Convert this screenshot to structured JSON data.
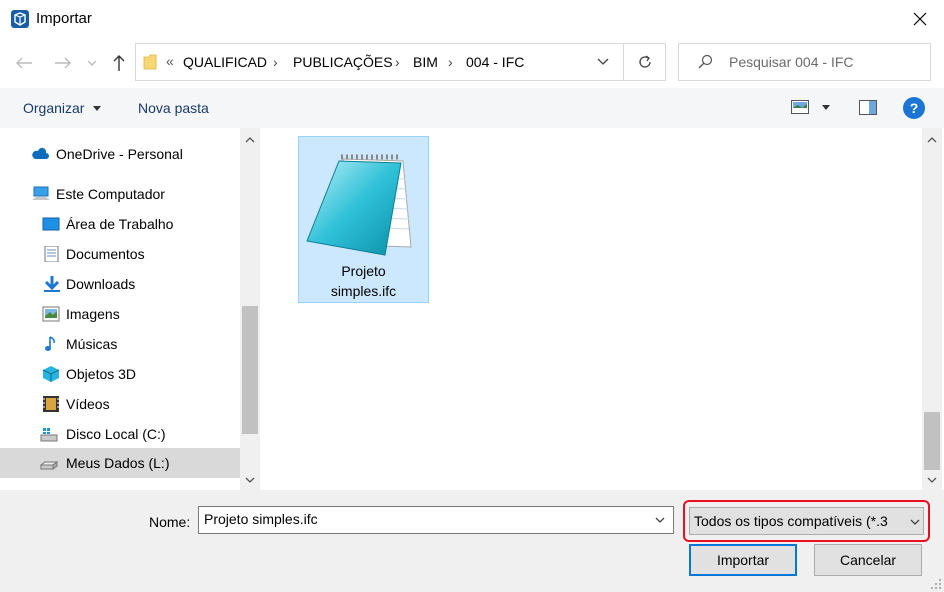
{
  "window": {
    "title": "Importar"
  },
  "nav": {
    "breadcrumb_overflow": "«",
    "breadcrumbs": [
      "QUALIFICAD",
      "PUBLICAÇÕES",
      "BIM",
      "004 - IFC"
    ],
    "search_placeholder": "Pesquisar 004 - IFC"
  },
  "toolbar": {
    "organize_label": "Organizar",
    "new_folder_label": "Nova pasta",
    "help_label": "?"
  },
  "sidebar": {
    "items": [
      {
        "label": "OneDrive - Personal",
        "icon": "onedrive-icon"
      },
      {
        "label": "Este Computador",
        "icon": "computer-icon"
      },
      {
        "label": "Área de Trabalho",
        "icon": "desktop-icon"
      },
      {
        "label": "Documentos",
        "icon": "documents-icon"
      },
      {
        "label": "Downloads",
        "icon": "downloads-icon"
      },
      {
        "label": "Imagens",
        "icon": "pictures-icon"
      },
      {
        "label": "Músicas",
        "icon": "music-icon"
      },
      {
        "label": "Objetos 3D",
        "icon": "objects-3d-icon"
      },
      {
        "label": "Vídeos",
        "icon": "videos-icon"
      },
      {
        "label": "Disco Local (C:)",
        "icon": "drive-c-icon"
      },
      {
        "label": "Meus Dados (L:)",
        "icon": "drive-l-icon",
        "selected": true
      }
    ]
  },
  "files": [
    {
      "name_line1": "Projeto",
      "name_line2": "simples.ifc",
      "icon": "notepad-file-icon"
    }
  ],
  "footer": {
    "name_label": "Nome:",
    "name_value": "Projeto simples.ifc",
    "file_type_value": "Todos os tipos compatíveis (*.3",
    "import_label": "Importar",
    "cancel_label": "Cancelar"
  },
  "colors": {
    "selection_bg": "#cce8ff",
    "highlight_border": "#e81123",
    "accent": "#0078d7"
  }
}
